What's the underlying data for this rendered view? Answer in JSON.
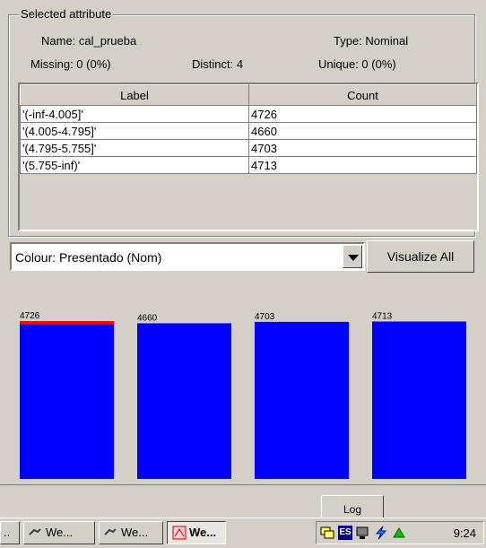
{
  "attribute": {
    "legend": "Selected attribute",
    "name": "Name: cal_prueba",
    "type": "Type: Nominal",
    "missing": "Missing: 0 (0%)",
    "distinct": "Distinct: 4",
    "unique": "Unique: 0 (0%)"
  },
  "table": {
    "headers": [
      "Label",
      "Count"
    ],
    "rows": [
      {
        "label": "'(-inf-4.005]'",
        "count": "4726"
      },
      {
        "label": "'(4.005-4.795]'",
        "count": "4660"
      },
      {
        "label": "'(4.795-5.755]'",
        "count": "4703"
      },
      {
        "label": "'(5.755-inf)'",
        "count": "4713"
      }
    ]
  },
  "colour_select": {
    "value": "Colour: Presentado (Nom)"
  },
  "visualize_button": {
    "label": "Visualize All"
  },
  "chart_data": {
    "type": "bar",
    "categories": [
      "'(-inf-4.005]'",
      "'(4.005-4.795]'",
      "'(4.795-5.755]'",
      "'(5.755-inf)'"
    ],
    "values": [
      4726,
      4660,
      4703,
      4713
    ],
    "data_labels": [
      "4726",
      "4660",
      "4703",
      "4713"
    ],
    "stacked_top_red": [
      110,
      0,
      0,
      0
    ],
    "colors": {
      "main": "#0000ff",
      "top": "#ff0000"
    }
  },
  "status": {
    "log_label": "Log"
  },
  "taskbar": {
    "items": [
      "..",
      "We...",
      "We...",
      "We..."
    ],
    "tray_lang": "ES",
    "clock": "9:24"
  }
}
